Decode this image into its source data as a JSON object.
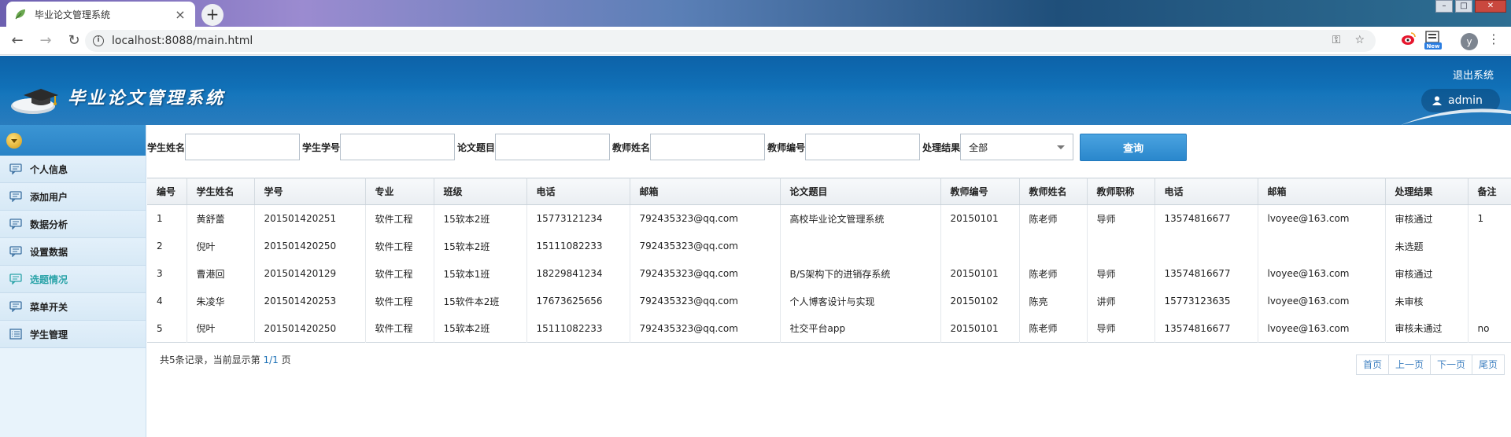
{
  "browser": {
    "tab_title": "毕业论文管理系统",
    "tab_close": "×",
    "new_tab": "+",
    "url": "localhost:8088/main.html",
    "ext_badge": "New",
    "profile_initial": "y"
  },
  "header": {
    "brand": "毕业论文管理系统",
    "logout": "退出系统",
    "user": "admin"
  },
  "sidebar": {
    "items": [
      {
        "label": "个人信息"
      },
      {
        "label": "添加用户"
      },
      {
        "label": "数据分析"
      },
      {
        "label": "设置数据"
      },
      {
        "label": "选题情况"
      },
      {
        "label": "菜单开关"
      },
      {
        "label": "学生管理"
      }
    ],
    "active_index": 4
  },
  "search": {
    "student_name_label": "学生姓名",
    "student_no_label": "学生学号",
    "thesis_label": "论文题目",
    "teacher_name_label": "教师姓名",
    "teacher_no_label": "教师编号",
    "result_label": "处理结果",
    "result_value": "全部",
    "query_button": "查询"
  },
  "table": {
    "headers": [
      "编号",
      "学生姓名",
      "学号",
      "专业",
      "班级",
      "电话",
      "邮箱",
      "论文题目",
      "教师编号",
      "教师姓名",
      "教师职称",
      "电话",
      "邮箱",
      "处理结果",
      "备注"
    ],
    "rows": [
      [
        "1",
        "黄舒蕾",
        "201501420251",
        "软件工程",
        "15软本2班",
        "15773121234",
        "792435323@qq.com",
        "高校毕业论文管理系统",
        "20150101",
        "陈老师",
        "导师",
        "13574816677",
        "lvoyee@163.com",
        "审核通过",
        "1"
      ],
      [
        "2",
        "倪叶",
        "201501420250",
        "软件工程",
        "15软本2班",
        "15111082233",
        "792435323@qq.com",
        "",
        "",
        "",
        "",
        "",
        "",
        "未选题",
        ""
      ],
      [
        "3",
        "曹港回",
        "201501420129",
        "软件工程",
        "15软本1班",
        "18229841234",
        "792435323@qq.com",
        "B/S架构下的进销存系统",
        "20150101",
        "陈老师",
        "导师",
        "13574816677",
        "lvoyee@163.com",
        "审核通过",
        ""
      ],
      [
        "4",
        "朱凌华",
        "201501420253",
        "软件工程",
        "15软件本2班",
        "17673625656",
        "792435323@qq.com",
        "个人博客设计与实现",
        "20150102",
        "陈亮",
        "讲师",
        "15773123635",
        "lvoyee@163.com",
        "未审核",
        ""
      ],
      [
        "5",
        "倪叶",
        "201501420250",
        "软件工程",
        "15软本2班",
        "15111082233",
        "792435323@qq.com",
        "社交平台app",
        "20150101",
        "陈老师",
        "导师",
        "13574816677",
        "lvoyee@163.com",
        "审核未通过",
        "no"
      ]
    ]
  },
  "footer": {
    "summary_prefix": "共5条记录，当前显示第",
    "summary_page": "1/1",
    "summary_suffix": "页",
    "pager": [
      "首页",
      "上一页",
      "下一页",
      "尾页"
    ]
  }
}
